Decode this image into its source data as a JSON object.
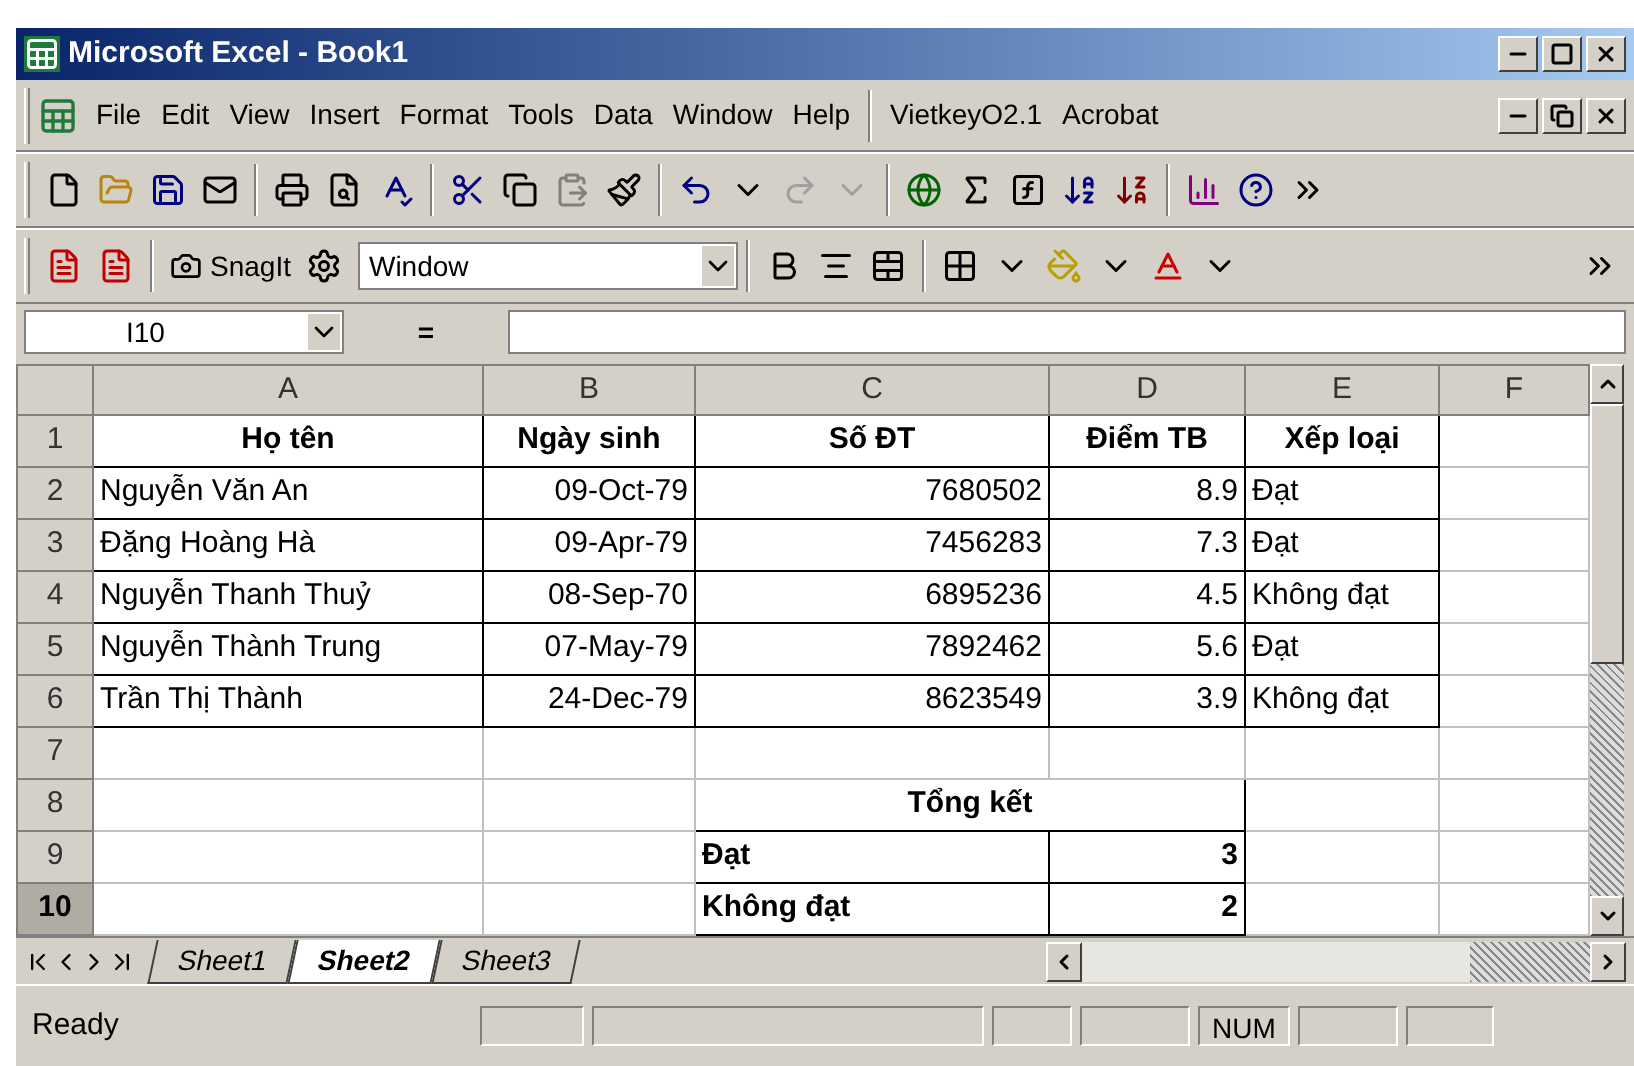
{
  "window": {
    "title": "Microsoft Excel - Book1"
  },
  "menu": [
    "File",
    "Edit",
    "View",
    "Insert",
    "Format",
    "Tools",
    "Data",
    "Window",
    "Help",
    "VietkeyO2.1",
    "Acrobat"
  ],
  "toolbar2": {
    "snagit": "SnagIt",
    "font_name": "Window"
  },
  "formula_bar": {
    "name_box": "I10",
    "equals": "="
  },
  "columns": [
    {
      "label": "A",
      "selected": false
    },
    {
      "label": "B",
      "selected": false
    },
    {
      "label": "C",
      "selected": false
    },
    {
      "label": "D",
      "selected": false
    },
    {
      "label": "E",
      "selected": false
    },
    {
      "label": "F",
      "selected": false
    }
  ],
  "row_headers": [
    {
      "label": "1",
      "selected": false
    },
    {
      "label": "2",
      "selected": false
    },
    {
      "label": "3",
      "selected": false
    },
    {
      "label": "4",
      "selected": false
    },
    {
      "label": "5",
      "selected": false
    },
    {
      "label": "6",
      "selected": false
    },
    {
      "label": "7",
      "selected": false
    },
    {
      "label": "8",
      "selected": false
    },
    {
      "label": "9",
      "selected": false
    },
    {
      "label": "10",
      "selected": true
    }
  ],
  "table": {
    "columns": [
      {
        "text": "Họ tên",
        "kind": "text"
      },
      {
        "text": "Ngày sinh",
        "kind": "number"
      },
      {
        "text": "Số ĐT",
        "kind": "number"
      },
      {
        "text": "Điểm TB",
        "kind": "number"
      },
      {
        "text": "Xếp loại",
        "kind": "text"
      }
    ],
    "rows": [
      [
        "Nguyễn Văn An",
        "09-Oct-79",
        "7680502",
        "8.9",
        "Đạt"
      ],
      [
        "Đặng Hoàng Hà",
        "09-Apr-79",
        "7456283",
        "7.3",
        "Đạt"
      ],
      [
        "Nguyễn Thanh Thuỷ",
        "08-Sep-70",
        "6895236",
        "4.5",
        "Không đạt"
      ],
      [
        "Nguyễn Thành Trung",
        "07-May-79",
        "7892462",
        "5.6",
        "Đạt"
      ],
      [
        "Trần Thị Thành",
        "24-Dec-79",
        "8623549",
        "3.9",
        "Không đạt"
      ]
    ]
  },
  "summary": {
    "title": "Tổng kết",
    "rows": [
      {
        "label": "Đạt",
        "value": "3"
      },
      {
        "label": "Không đạt",
        "value": "2"
      }
    ]
  },
  "sheet_tabs": [
    {
      "label": "Sheet1",
      "selected": false
    },
    {
      "label": "Sheet2",
      "selected": true
    },
    {
      "label": "Sheet3",
      "selected": false
    }
  ],
  "status_bar": {
    "text": "Ready",
    "indicator": "NUM"
  }
}
